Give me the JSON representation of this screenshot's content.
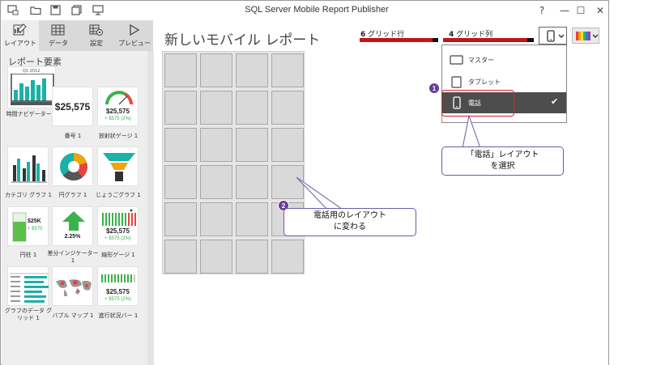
{
  "window": {
    "title": "SQL Server Mobile Report Publisher"
  },
  "window_controls": {
    "help": "?",
    "minimize": "—",
    "maximize": "☐",
    "close": "✕"
  },
  "left_panel": {
    "tabs": [
      {
        "label": "レイアウト",
        "icon": "layout-icon"
      },
      {
        "label": "データ",
        "icon": "data-icon"
      },
      {
        "label": "設定",
        "icon": "settings-icon"
      },
      {
        "label": "プレビュー",
        "icon": "preview-icon"
      }
    ],
    "section_title": "レポート要素",
    "elements": [
      {
        "label": "時間ナビゲーター 1"
      },
      {
        "label": "番号 1",
        "value": "$25,575"
      },
      {
        "label": "放射状ゲージ 1",
        "value": "$25,575",
        "delta": "+ $575 (2%)"
      },
      {
        "label": "カテゴリ グラフ 1"
      },
      {
        "label": "円グラフ 1"
      },
      {
        "label": "じょうごグラフ 1"
      },
      {
        "label": "円柱 1",
        "value": "$25K",
        "delta": "+ $575"
      },
      {
        "label": "差分インジケーター 1",
        "value": "2.25%"
      },
      {
        "label": "線形ゲージ 1",
        "value": "$25,575",
        "delta": "+ $575 (2%)"
      },
      {
        "label": "グラフのデータ グリッド 1"
      },
      {
        "label": "バブル マップ 1"
      },
      {
        "label": "進行状況バー 1",
        "value": "$25,575",
        "delta": "+ $575 (2%)"
      }
    ],
    "time_nav_caption": "Q1 2012"
  },
  "canvas": {
    "title": "新しいモバイル レポート",
    "grid_rows_value": "6",
    "grid_rows_label": "グリッド行",
    "grid_cols_value": "4",
    "grid_cols_label": "グリッド列",
    "rows": 6,
    "cols": 4
  },
  "device_menu": {
    "items": [
      {
        "label": "マスター",
        "icon": "monitor-icon"
      },
      {
        "label": "タブレット",
        "icon": "tablet-icon"
      },
      {
        "label": "電話",
        "icon": "phone-icon",
        "selected": true
      }
    ],
    "check": "✔"
  },
  "annotations": {
    "badge1": "1",
    "badge2": "2",
    "callout1_line1": "「電話」レイアウト",
    "callout1_line2": "を選択",
    "callout2_line1": "電話用のレイアウト",
    "callout2_line2": "に変わる"
  },
  "colors": {
    "accent_red": "#c0141c",
    "tile_teal": "#1ab1a6",
    "annotation_purple": "#6a3d9a",
    "selection_box": "#d9232a"
  }
}
